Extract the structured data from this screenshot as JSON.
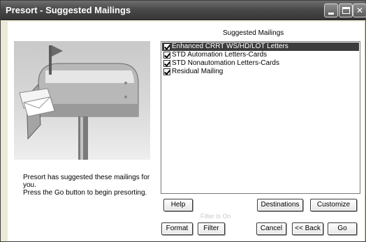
{
  "window": {
    "title": "Presort - Suggested Mailings",
    "controls": {
      "minimize": "minimize-icon",
      "maximize": "maximize-icon",
      "close": "close-icon"
    }
  },
  "illustration": {
    "icon": "mailbox-icon",
    "caption_line1": "Presort has suggested these mailings for you.",
    "caption_line2": "Press the Go button to begin presorting."
  },
  "mailings": {
    "heading": "Suggested Mailings",
    "items": [
      {
        "label": "Enhanced CRRT WS/HD/LOT Letters",
        "checked": true,
        "selected": true
      },
      {
        "label": "STD Automation Letters-Cards",
        "checked": true,
        "selected": false
      },
      {
        "label": "STD Nonautomation Letters-Cards",
        "checked": true,
        "selected": false
      },
      {
        "label": "Residual Mailing",
        "checked": true,
        "selected": false
      }
    ]
  },
  "buttons": {
    "help": "Help",
    "destinations": "Destinations",
    "customize": "Customize",
    "format": "Format",
    "filter": "Filter",
    "cancel": "Cancel",
    "back": "<< Back",
    "go": "Go"
  },
  "filter_status": "Filter is On",
  "colors": {
    "title_bar": "#4a4a4a",
    "dialog_background": "#ece9d8",
    "selection": "#3c3c3c",
    "disabled_text": "#c8c8c8"
  }
}
